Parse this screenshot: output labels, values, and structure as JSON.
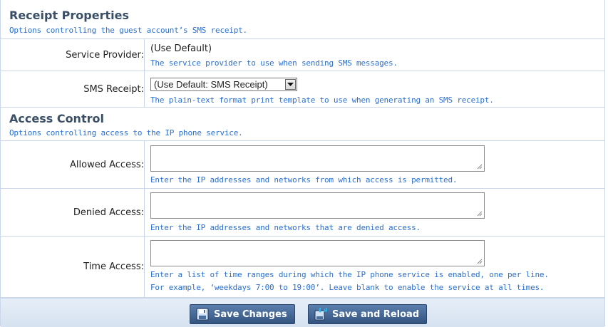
{
  "receipt": {
    "title": "Receipt Properties",
    "description": "Options controlling the guest account’s SMS receipt.",
    "service_provider": {
      "label": "Service Provider:",
      "value": "(Use Default)",
      "hint": "The service provider to use when sending SMS messages."
    },
    "sms_receipt": {
      "label": "SMS Receipt:",
      "selected": "(Use Default: SMS Receipt)",
      "hint": "The plain-text format print template to use when generating an SMS receipt."
    }
  },
  "access": {
    "title": "Access Control",
    "description": "Options controlling access to the IP phone service.",
    "allowed": {
      "label": "Allowed Access:",
      "value": "",
      "hint": "Enter the IP addresses and networks from which access is permitted."
    },
    "denied": {
      "label": "Denied Access:",
      "value": "",
      "hint": "Enter the IP addresses and networks that are denied access."
    },
    "time": {
      "label": "Time Access:",
      "value": "",
      "hint_line1": "Enter a list of time ranges during which the IP phone service is enabled, one per line.",
      "hint_line2": "For example, ‘weekdays 7:00 to 19:00’. Leave blank to enable the service at all times."
    }
  },
  "footer": {
    "save_label": "Save Changes",
    "save_reload_label": "Save and Reload"
  },
  "icons": {
    "save": "floppy-disk-icon",
    "save_reload": "save-reload-icon"
  },
  "colors": {
    "section_title": "#3a4f66",
    "hint_text": "#2a6fd0",
    "button_bg": "#34547f",
    "border": "#c9d7e8"
  }
}
